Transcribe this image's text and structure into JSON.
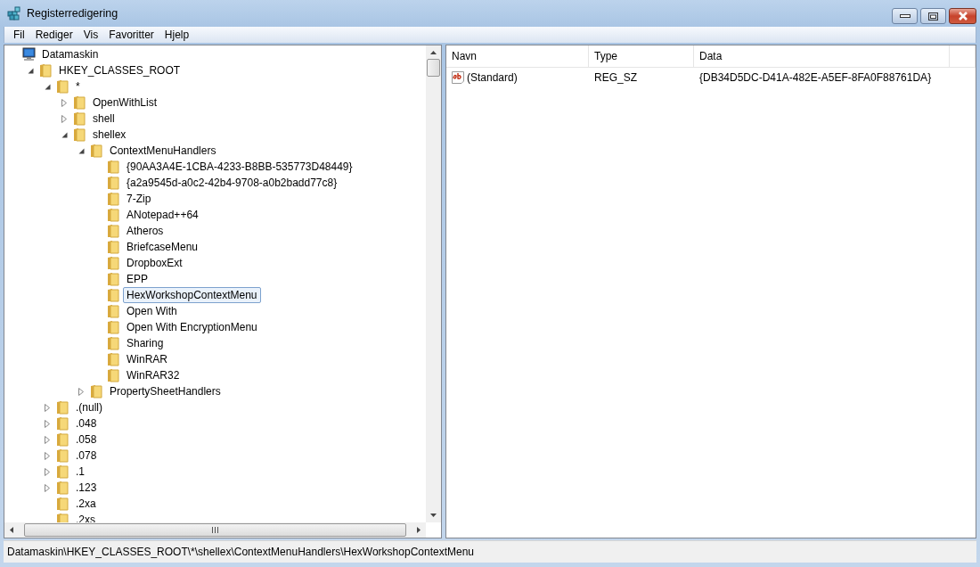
{
  "window": {
    "title": "Registerredigering"
  },
  "menu": [
    "Fil",
    "Rediger",
    "Vis",
    "Favoritter",
    "Hjelp"
  ],
  "tree": [
    {
      "label": "Datamaskin",
      "kind": "computer",
      "selected": false,
      "children": [
        {
          "label": "HKEY_CLASSES_ROOT",
          "kind": "folder",
          "expanded": true,
          "selected": false,
          "children": [
            {
              "label": "*",
              "kind": "folder",
              "expanded": true,
              "selected": false,
              "children": [
                {
                  "label": "OpenWithList",
                  "kind": "folder",
                  "expanded": false,
                  "selected": false
                },
                {
                  "label": "shell",
                  "kind": "folder",
                  "expanded": false,
                  "selected": false
                },
                {
                  "label": "shellex",
                  "kind": "folder",
                  "expanded": true,
                  "selected": false,
                  "children": [
                    {
                      "label": "ContextMenuHandlers",
                      "kind": "folder",
                      "expanded": true,
                      "selected": false,
                      "children": [
                        {
                          "label": "{90AA3A4E-1CBA-4233-B8BB-535773D48449}",
                          "kind": "folder",
                          "selected": false
                        },
                        {
                          "label": "{a2a9545d-a0c2-42b4-9708-a0b2badd77c8}",
                          "kind": "folder",
                          "selected": false
                        },
                        {
                          "label": "7-Zip",
                          "kind": "folder",
                          "selected": false
                        },
                        {
                          "label": "ANotepad++64",
                          "kind": "folder",
                          "selected": false
                        },
                        {
                          "label": "Atheros",
                          "kind": "folder",
                          "selected": false
                        },
                        {
                          "label": "BriefcaseMenu",
                          "kind": "folder",
                          "selected": false
                        },
                        {
                          "label": "DropboxExt",
                          "kind": "folder",
                          "selected": false
                        },
                        {
                          "label": "EPP",
                          "kind": "folder",
                          "selected": false
                        },
                        {
                          "label": "HexWorkshopContextMenu",
                          "kind": "folder",
                          "selected": true
                        },
                        {
                          "label": "Open With",
                          "kind": "folder",
                          "selected": false
                        },
                        {
                          "label": "Open With EncryptionMenu",
                          "kind": "folder",
                          "selected": false
                        },
                        {
                          "label": "Sharing",
                          "kind": "folder",
                          "selected": false
                        },
                        {
                          "label": "WinRAR",
                          "kind": "folder",
                          "selected": false
                        },
                        {
                          "label": "WinRAR32",
                          "kind": "folder",
                          "selected": false
                        }
                      ]
                    },
                    {
                      "label": "PropertySheetHandlers",
                      "kind": "folder",
                      "expanded": false,
                      "selected": false
                    }
                  ]
                }
              ]
            },
            {
              "label": ".(null)",
              "kind": "folder",
              "expanded": false,
              "selected": false
            },
            {
              "label": ".048",
              "kind": "folder",
              "expanded": false,
              "selected": false
            },
            {
              "label": ".058",
              "kind": "folder",
              "expanded": false,
              "selected": false
            },
            {
              "label": ".078",
              "kind": "folder",
              "expanded": false,
              "selected": false
            },
            {
              "label": ".1",
              "kind": "folder",
              "expanded": false,
              "selected": false
            },
            {
              "label": ".123",
              "kind": "folder",
              "expanded": false,
              "selected": false
            },
            {
              "label": ".2xa",
              "kind": "folder",
              "selected": false
            },
            {
              "label": ".2xs",
              "kind": "folder",
              "selected": false
            }
          ]
        }
      ]
    }
  ],
  "values": {
    "columns": [
      "Navn",
      "Type",
      "Data"
    ],
    "rows": [
      {
        "name": "(Standard)",
        "kind": "string",
        "type": "REG_SZ",
        "data": "{DB34D5DC-D41A-482E-A5EF-8FA0F88761DA}"
      }
    ]
  },
  "status_bar": "Datamaskin\\HKEY_CLASSES_ROOT\\*\\shellex\\ContextMenuHandlers\\HexWorkshopContextMenu"
}
